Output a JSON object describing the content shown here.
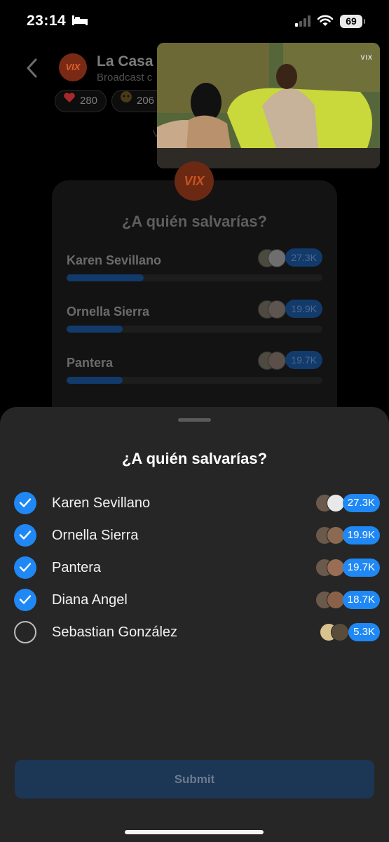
{
  "status": {
    "time": "23:14",
    "battery": "69"
  },
  "channel": {
    "logo": "VIX",
    "title": "La Casa",
    "subtitle": "Broadcast c"
  },
  "reactions": [
    {
      "icon": "heart-icon",
      "count": "280"
    },
    {
      "icon": "emoji-icon",
      "count": "206"
    }
  ],
  "background_letter": "V",
  "video": {
    "logo": "VIX"
  },
  "background_poll": {
    "logo": "VIX",
    "question": "¿A quién salvarías?",
    "options": [
      {
        "label": "Karen Sevillano",
        "count": "27.3K",
        "fill": 0.3
      },
      {
        "label": "Ornella Sierra",
        "count": "19.9K",
        "fill": 0.22
      },
      {
        "label": "Pantera",
        "count": "19.7K",
        "fill": 0.22
      }
    ]
  },
  "sheet": {
    "question": "¿A quién salvarías?",
    "options": [
      {
        "label": "Karen Sevillano",
        "count": "27.3K",
        "checked": true
      },
      {
        "label": "Ornella Sierra",
        "count": "19.9K",
        "checked": true
      },
      {
        "label": "Pantera",
        "count": "19.7K",
        "checked": true
      },
      {
        "label": "Diana Angel",
        "count": "18.7K",
        "checked": true
      },
      {
        "label": "Sebastian González",
        "count": "5.3K",
        "checked": false
      }
    ],
    "submit_label": "Submit"
  },
  "colors": {
    "accent": "#1f88f4",
    "sheet_bg": "#262626",
    "submit_bg": "#1c3656"
  }
}
